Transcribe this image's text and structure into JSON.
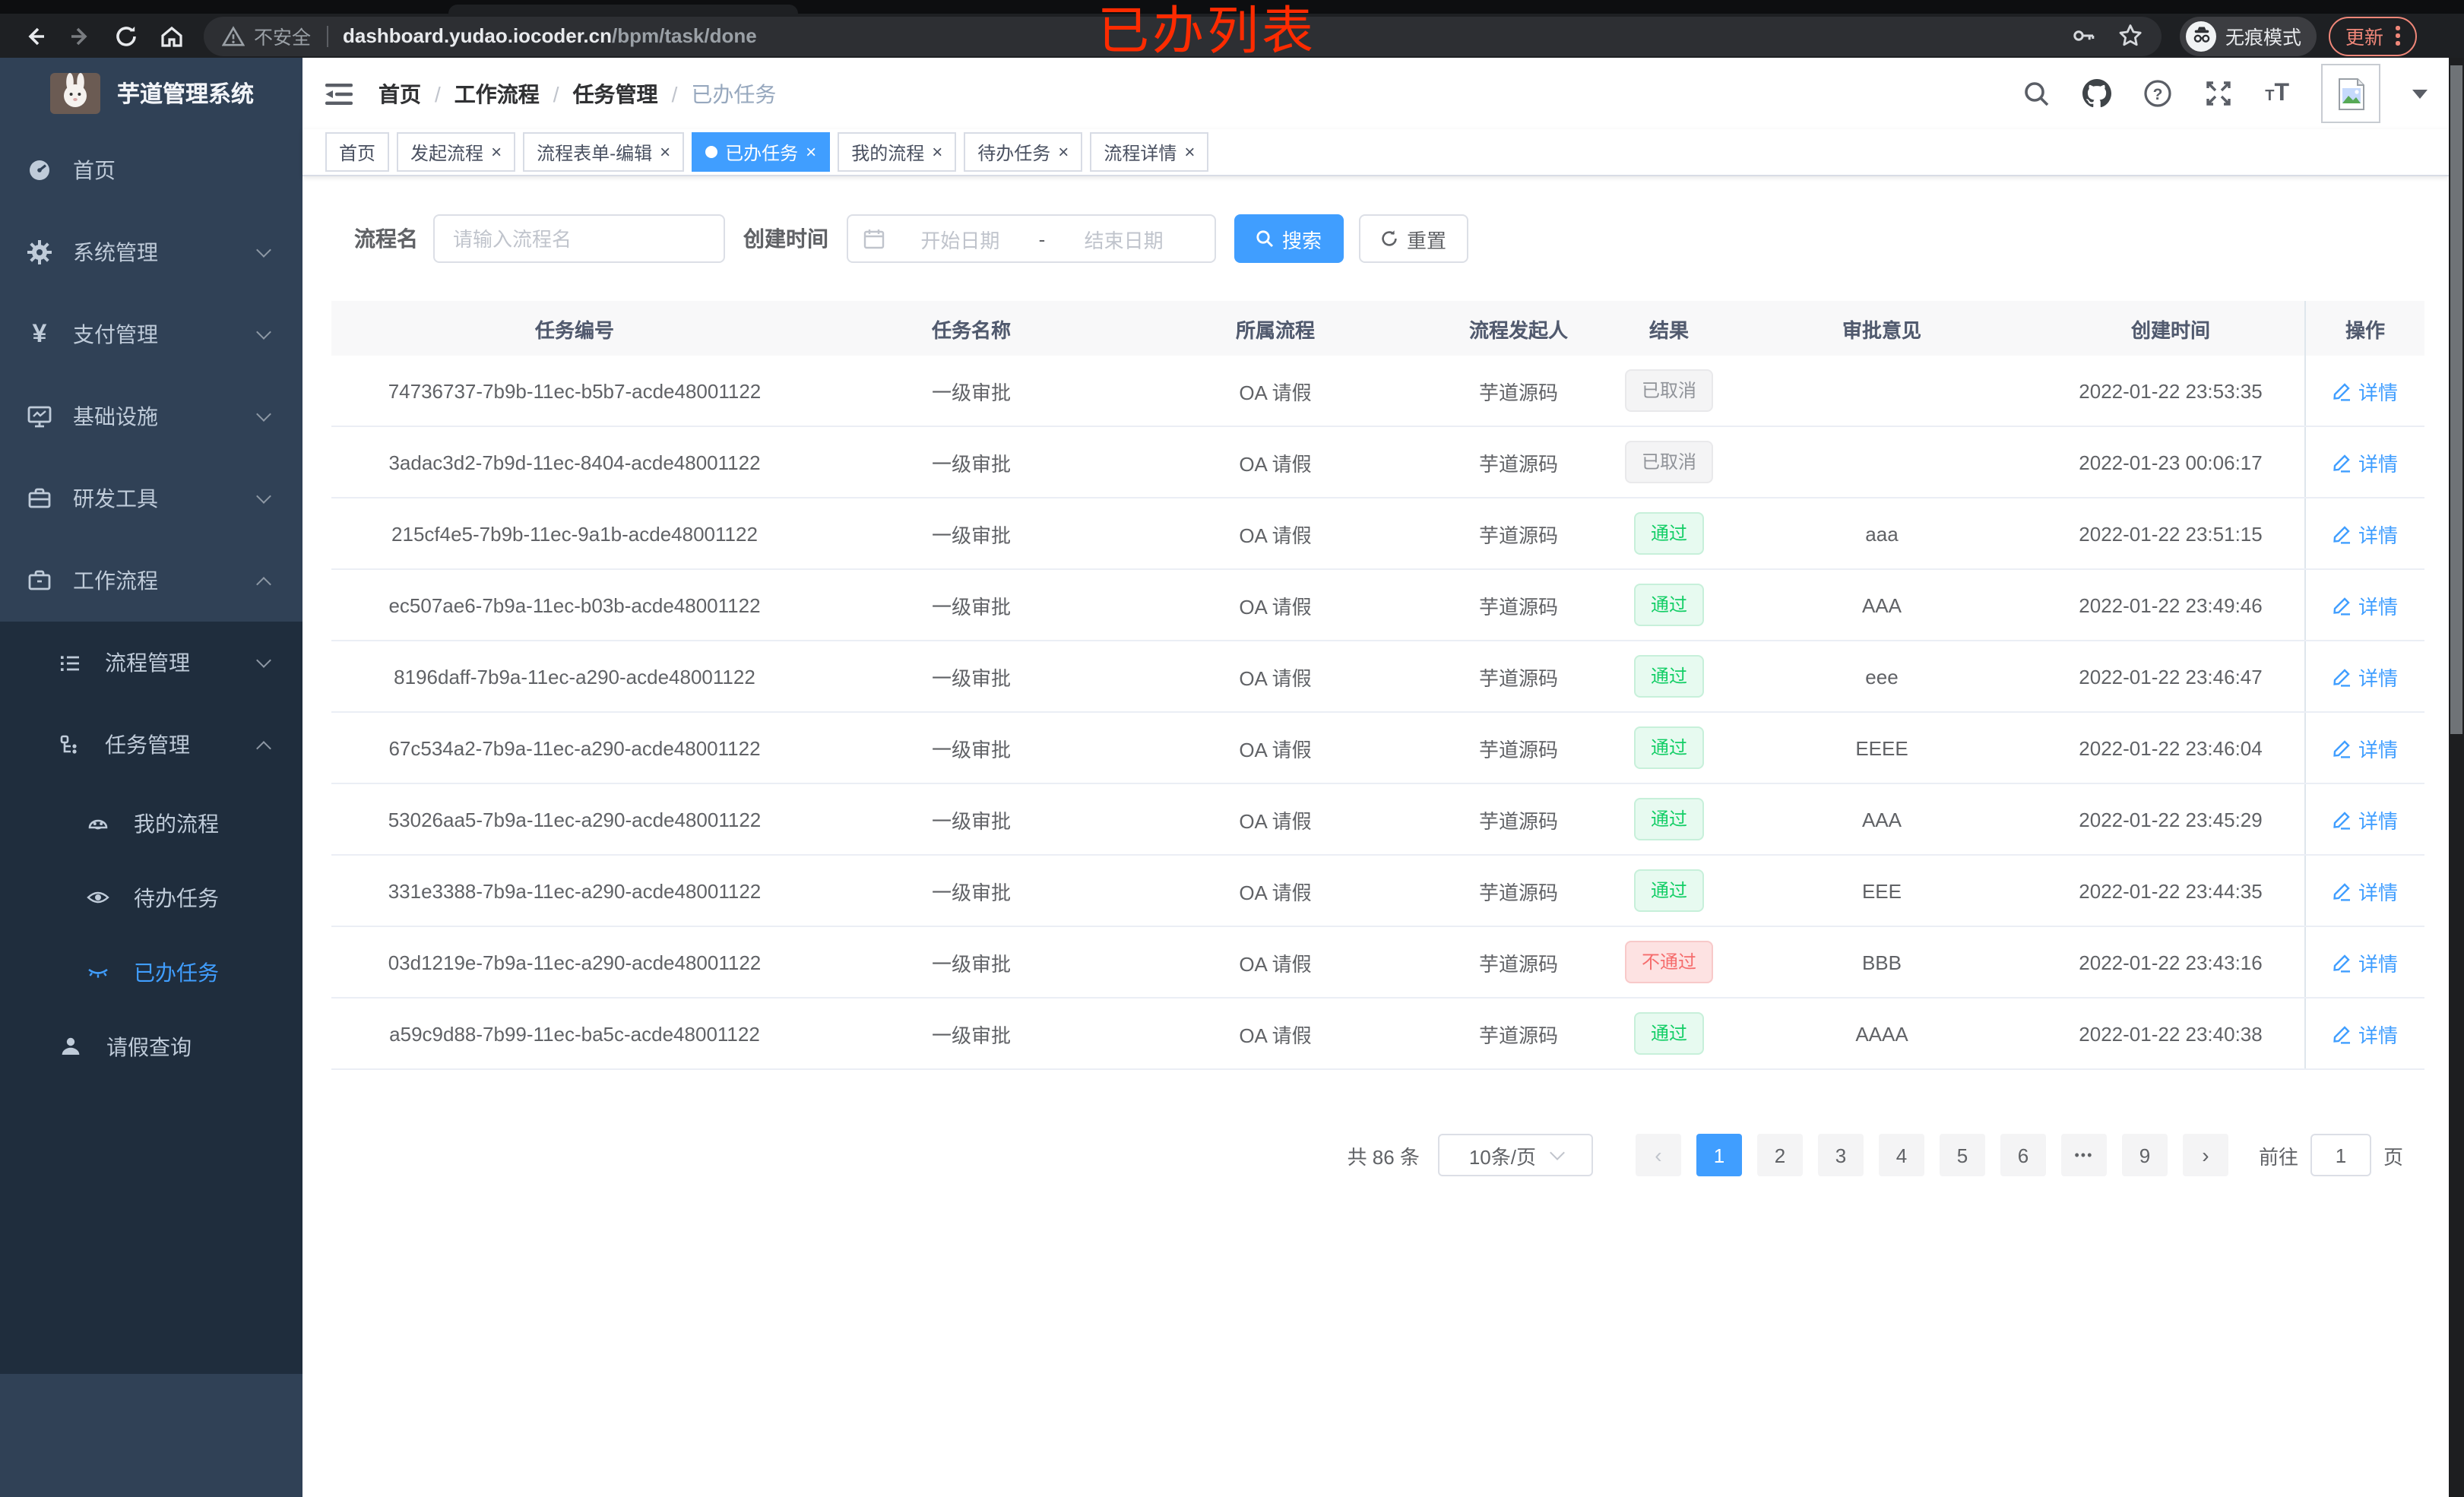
{
  "browser": {
    "security_label": "不安全",
    "url_host": "dashboard.yudao.iocoder.cn",
    "url_path": "/bpm/task/done",
    "incognito_label": "无痕模式",
    "update_label": "更新"
  },
  "annotation": "已办列表",
  "glyphs": {
    "close": "×",
    "prev": "‹",
    "next": "›",
    "ellipsis": "•••"
  },
  "colors": {
    "accent": "#409eff",
    "success": "#13ce66",
    "danger": "#f56c6c",
    "info": "#909399",
    "annotation": "#fe2b00",
    "sidebar": "#304156",
    "submenu": "#1f2d3d"
  },
  "sidebar": {
    "title": "芋道管理系统",
    "items": [
      {
        "label": "首页"
      },
      {
        "label": "系统管理"
      },
      {
        "label": "支付管理"
      },
      {
        "label": "基础设施"
      },
      {
        "label": "研发工具"
      },
      {
        "label": "工作流程"
      }
    ],
    "submenu": [
      {
        "label": "流程管理"
      },
      {
        "label": "任务管理"
      }
    ],
    "task_children": [
      {
        "label": "我的流程"
      },
      {
        "label": "待办任务"
      },
      {
        "label": "已办任务"
      }
    ],
    "leave_label": "请假查询"
  },
  "header": {
    "breadcrumb": [
      "首页",
      "工作流程",
      "任务管理",
      "已办任务"
    ]
  },
  "tabs": [
    {
      "label": "首页"
    },
    {
      "label": "发起流程"
    },
    {
      "label": "流程表单-编辑"
    },
    {
      "label": "已办任务"
    },
    {
      "label": "我的流程"
    },
    {
      "label": "待办任务"
    },
    {
      "label": "流程详情"
    }
  ],
  "filters": {
    "name_label": "流程名",
    "name_placeholder": "请输入流程名",
    "time_label": "创建时间",
    "start_placeholder": "开始日期",
    "range_separator": "-",
    "end_placeholder": "结束日期",
    "search_label": "搜索",
    "reset_label": "重置"
  },
  "table": {
    "columns": [
      "任务编号",
      "任务名称",
      "所属流程",
      "流程发起人",
      "结果",
      "审批意见",
      "创建时间",
      "操作"
    ],
    "action_label": "详情",
    "rows": [
      {
        "id": "74736737-7b9b-11ec-b5b7-acde48001122",
        "name": "一级审批",
        "process": "OA 请假",
        "starter": "芋道源码",
        "result": "已取消",
        "result_type": "info",
        "comment": "",
        "created": "2022-01-22 23:53:35"
      },
      {
        "id": "3adac3d2-7b9d-11ec-8404-acde48001122",
        "name": "一级审批",
        "process": "OA 请假",
        "starter": "芋道源码",
        "result": "已取消",
        "result_type": "info",
        "comment": "",
        "created": "2022-01-23 00:06:17"
      },
      {
        "id": "215cf4e5-7b9b-11ec-9a1b-acde48001122",
        "name": "一级审批",
        "process": "OA 请假",
        "starter": "芋道源码",
        "result": "通过",
        "result_type": "success",
        "comment": "aaa",
        "created": "2022-01-22 23:51:15"
      },
      {
        "id": "ec507ae6-7b9a-11ec-b03b-acde48001122",
        "name": "一级审批",
        "process": "OA 请假",
        "starter": "芋道源码",
        "result": "通过",
        "result_type": "success",
        "comment": "AAA",
        "created": "2022-01-22 23:49:46"
      },
      {
        "id": "8196daff-7b9a-11ec-a290-acde48001122",
        "name": "一级审批",
        "process": "OA 请假",
        "starter": "芋道源码",
        "result": "通过",
        "result_type": "success",
        "comment": "eee",
        "created": "2022-01-22 23:46:47"
      },
      {
        "id": "67c534a2-7b9a-11ec-a290-acde48001122",
        "name": "一级审批",
        "process": "OA 请假",
        "starter": "芋道源码",
        "result": "通过",
        "result_type": "success",
        "comment": "EEEE",
        "created": "2022-01-22 23:46:04"
      },
      {
        "id": "53026aa5-7b9a-11ec-a290-acde48001122",
        "name": "一级审批",
        "process": "OA 请假",
        "starter": "芋道源码",
        "result": "通过",
        "result_type": "success",
        "comment": "AAA",
        "created": "2022-01-22 23:45:29"
      },
      {
        "id": "331e3388-7b9a-11ec-a290-acde48001122",
        "name": "一级审批",
        "process": "OA 请假",
        "starter": "芋道源码",
        "result": "通过",
        "result_type": "success",
        "comment": "EEE",
        "created": "2022-01-22 23:44:35"
      },
      {
        "id": "03d1219e-7b9a-11ec-a290-acde48001122",
        "name": "一级审批",
        "process": "OA 请假",
        "starter": "芋道源码",
        "result": "不通过",
        "result_type": "danger",
        "comment": "BBB",
        "created": "2022-01-22 23:43:16"
      },
      {
        "id": "a59c9d88-7b99-11ec-ba5c-acde48001122",
        "name": "一级审批",
        "process": "OA 请假",
        "starter": "芋道源码",
        "result": "通过",
        "result_type": "success",
        "comment": "AAAA",
        "created": "2022-01-22 23:40:38"
      }
    ]
  },
  "pagination": {
    "total_label": "共 86 条",
    "page_size_label": "10条/页",
    "pages": [
      "1",
      "2",
      "3",
      "4",
      "5",
      "6"
    ],
    "last_page": "9",
    "goto_label": "前往",
    "goto_value": "1",
    "unit_label": "页"
  }
}
